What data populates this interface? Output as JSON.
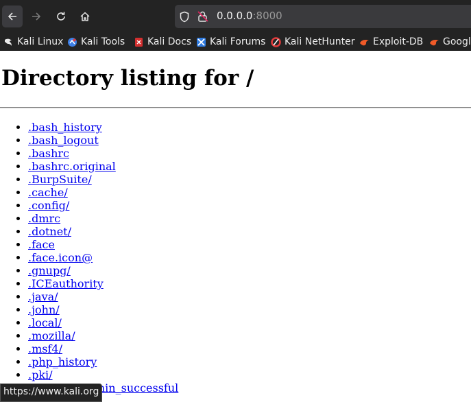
{
  "toolbar": {
    "url_host": "0.0.0.0",
    "url_port": ":8000"
  },
  "bookmarks": [
    {
      "label": "Kali Linux",
      "icon": "kali-dragon-icon"
    },
    {
      "label": "Kali Tools",
      "icon": "kali-tools-icon"
    },
    {
      "label": "Kali Docs",
      "icon": "kali-docs-icon"
    },
    {
      "label": "Kali Forums",
      "icon": "kali-forums-icon"
    },
    {
      "label": "Kali NetHunter",
      "icon": "nethunter-icon"
    },
    {
      "label": "Exploit-DB",
      "icon": "exploit-db-icon"
    },
    {
      "label": "Googl",
      "icon": "ghdb-icon"
    }
  ],
  "page": {
    "title": "Directory listing for /",
    "files": [
      ".bash_history",
      ".bash_logout",
      ".bashrc",
      ".bashrc.original",
      ".BurpSuite/",
      ".cache/",
      ".config/",
      ".dmrc",
      ".dotnet/",
      ".face",
      ".face.icon@",
      ".gnupg/",
      ".ICEauthority",
      ".java/",
      ".john/",
      ".local/",
      ".mozilla/",
      ".msf4/",
      ".php_history",
      ".pki/",
      ".sudo_as_admin_successful"
    ]
  },
  "status_bar": {
    "hover_url": "https://www.kali.org"
  },
  "colors": {
    "chrome_bg": "#232323",
    "link": "#0000ee"
  }
}
